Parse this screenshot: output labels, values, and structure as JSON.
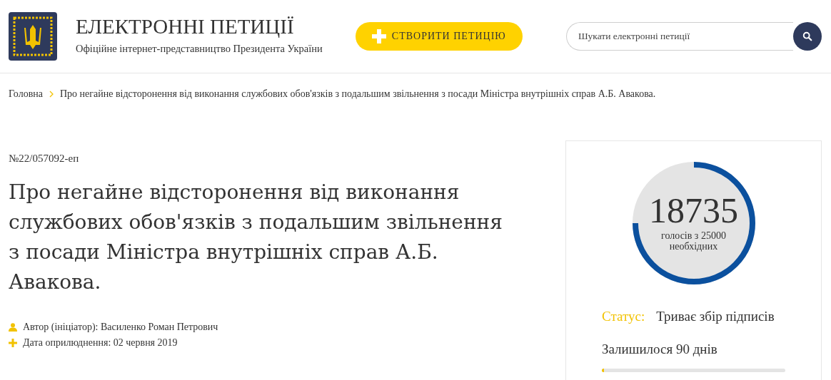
{
  "header": {
    "title": "ЕЛЕКТРОННІ ПЕТИЦІЇ",
    "subtitle": "Офіційне інтернет-представництво Президента України",
    "create_button": "СТВОРИТИ ПЕТИЦІЮ",
    "search": {
      "placeholder": "Шукати електронні петиції"
    }
  },
  "breadcrumb": [
    "Головна",
    "Про негайне відсторонення від виконання службових обов'язків з подальшим звільнення з посади Міністра внутрішніх справ А.Б. Авакова."
  ],
  "petition": {
    "number": "№22/057092-еп",
    "title": "Про негайне відсторонення від виконання службових обов'язків з подальшим звільнення з посади Міністра внутрішніх справ А.Б. Авакова.",
    "meta": [
      {
        "kind": "author",
        "text": "Автор (ініціатор): Василенко Роман Петрович"
      },
      {
        "kind": "date",
        "text": "Дата оприлюднення: 02 червня 2019"
      }
    ]
  },
  "votes": {
    "count": "18735",
    "caption": "голосів з 25000 необхідних",
    "level": 0.749,
    "status_label": "Статус:",
    "status": "Триває збір підписів",
    "remaining": "Залишилося 90 днів"
  },
  "time_progress": {
    "level": 0.01
  }
}
